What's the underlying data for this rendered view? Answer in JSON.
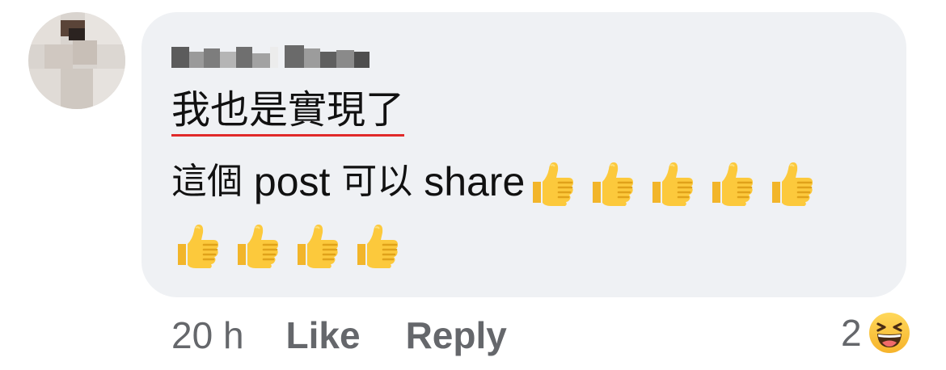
{
  "comment": {
    "author_name": "",
    "text_line1": "我也是實現了",
    "text_line2_cjk_prefix": "這個",
    "text_line2_latin": " post ",
    "text_line2_cjk_mid": "可以",
    "text_line2_latin_end": " share",
    "thumbs_up_emoji_count": 9
  },
  "actions": {
    "timestamp": "20 h",
    "like_label": "Like",
    "reply_label": "Reply"
  },
  "reactions": {
    "count": "2",
    "type": "haha"
  },
  "colors": {
    "bubble_bg": "#eff1f4",
    "meta_text": "#65676b",
    "body_text": "#111111",
    "underline": "#e02a2a"
  }
}
